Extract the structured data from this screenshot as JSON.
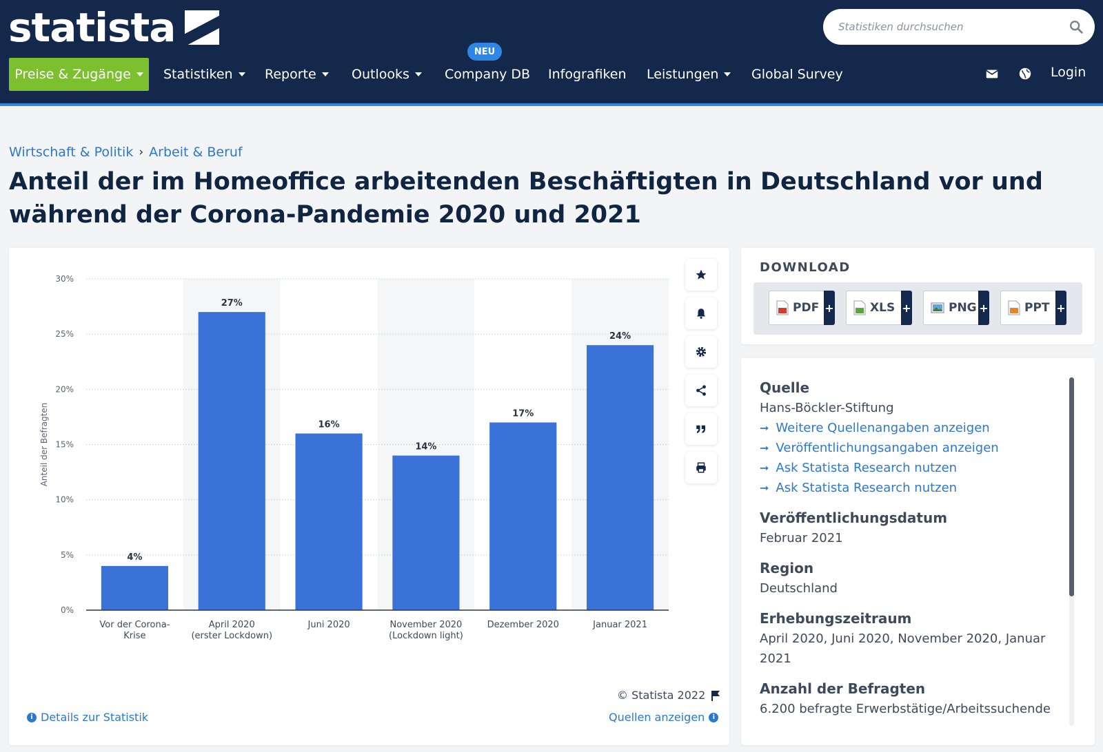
{
  "header": {
    "logo_text": "statista",
    "search_placeholder": "Statistiken durchsuchen",
    "login": "Login"
  },
  "nav": {
    "items": [
      {
        "label": "Preise & Zugänge"
      },
      {
        "label": "Statistiken"
      },
      {
        "label": "Reporte"
      },
      {
        "label": "Outlooks"
      },
      {
        "label": "Company DB"
      },
      {
        "label": "Infografiken"
      },
      {
        "label": "Leistungen"
      },
      {
        "label": "Global Survey"
      }
    ],
    "badge": "NEU"
  },
  "breadcrumb": [
    "Wirtschaft & Politik",
    "Arbeit & Beruf"
  ],
  "page_title": "Anteil der im Homeoffice arbeitenden Beschäftigten in Deutschland vor und während der Corona-Pandemie 2020 und 2021",
  "chart_data": {
    "type": "bar",
    "categories": [
      [
        "Vor der Corona-",
        "Krise"
      ],
      [
        "April 2020",
        "(erster Lockdown)"
      ],
      [
        "Juni 2020"
      ],
      [
        "November 2020",
        "(Lockdown light)"
      ],
      [
        "Dezember 2020"
      ],
      [
        "Januar 2021"
      ]
    ],
    "values": [
      4,
      27,
      16,
      14,
      17,
      24
    ],
    "value_labels": [
      "4%",
      "27%",
      "16%",
      "14%",
      "17%",
      "24%"
    ],
    "ylabel": "Anteil der Befragten",
    "ylim": [
      0,
      30
    ],
    "yticks": [
      0,
      5,
      10,
      15,
      20,
      25,
      30
    ],
    "ytick_labels": [
      "0%",
      "5%",
      "10%",
      "15%",
      "20%",
      "25%",
      "30%"
    ],
    "grid": true,
    "bar_color": "#3a72d8"
  },
  "chart_footer": {
    "copyright": "© Statista 2022",
    "details": "Details zur Statistik",
    "sources": "Quellen anzeigen"
  },
  "tools": [
    "star-icon",
    "bell-icon",
    "gear-icon",
    "share-icon",
    "quote-icon",
    "print-icon"
  ],
  "download": {
    "title": "DOWNLOAD",
    "buttons": [
      {
        "label": "PDF",
        "plus": "+"
      },
      {
        "label": "XLS",
        "plus": "+"
      },
      {
        "label": "PNG",
        "plus": "+"
      },
      {
        "label": "PPT",
        "plus": "+"
      }
    ]
  },
  "info": {
    "source_heading": "Quelle",
    "source_value": "Hans-Böckler-Stiftung",
    "links": [
      "Weitere Quellenangaben anzeigen",
      "Veröffentlichungsangaben anzeigen",
      "Ask Statista Research nutzen",
      "Ask Statista Research nutzen"
    ],
    "date_heading": "Veröffentlichungsdatum",
    "date_value": "Februar 2021",
    "region_heading": "Region",
    "region_value": "Deutschland",
    "period_heading": "Erhebungszeitraum",
    "period_value": "April 2020, Juni 2020, November 2020, Januar 2021",
    "respondents_heading": "Anzahl der Befragten",
    "respondents_value": "6.200 befragte Erwerbstätige/Arbeitssuchende"
  },
  "colors": {
    "header_bg": "#14284c",
    "accent_green": "#7cbf2f",
    "link_blue": "#2b78d1",
    "bar_blue": "#3a72d8"
  }
}
